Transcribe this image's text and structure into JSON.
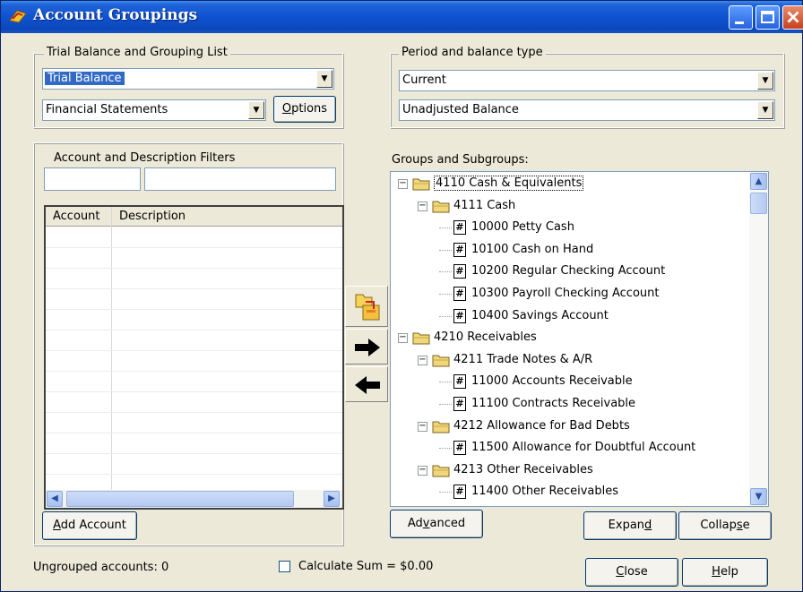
{
  "window": {
    "title": "Account Groupings"
  },
  "trial_balance": {
    "group_label": "Trial Balance and Grouping List",
    "balance_select": "Trial Balance",
    "grouping_select": "Financial Statements",
    "options_button": "Options"
  },
  "period": {
    "group_label": "Period and balance type",
    "period_select": "Current",
    "balance_type_select": "Unadjusted Balance"
  },
  "filters": {
    "group_label": "Account and Description Filters",
    "account_filter": "",
    "description_filter": ""
  },
  "account_list": {
    "columns": [
      "Account",
      "Description"
    ],
    "rows": []
  },
  "tree": {
    "label": "Groups and Subgroups:",
    "nodes": [
      {
        "text": "4110  Cash & Equivalents",
        "level": 0,
        "kind": "folder"
      },
      {
        "text": "4111  Cash",
        "level": 1,
        "kind": "folder"
      },
      {
        "text": "10000  Petty Cash",
        "level": 2,
        "kind": "account"
      },
      {
        "text": "10100  Cash on Hand",
        "level": 2,
        "kind": "account"
      },
      {
        "text": "10200  Regular Checking Account",
        "level": 2,
        "kind": "account"
      },
      {
        "text": "10300  Payroll Checking Account",
        "level": 2,
        "kind": "account"
      },
      {
        "text": "10400  Savings Account",
        "level": 2,
        "kind": "account"
      },
      {
        "text": "4210  Receivables",
        "level": 0,
        "kind": "folder"
      },
      {
        "text": "4211  Trade Notes & A/R",
        "level": 1,
        "kind": "folder"
      },
      {
        "text": "11000  Accounts Receivable",
        "level": 2,
        "kind": "account"
      },
      {
        "text": "11100  Contracts Receivable",
        "level": 2,
        "kind": "account"
      },
      {
        "text": "4212  Allowance for Bad Debts",
        "level": 1,
        "kind": "folder"
      },
      {
        "text": "11500  Allowance for Doubtful Account",
        "level": 2,
        "kind": "account"
      },
      {
        "text": "4213  Other Receivables",
        "level": 1,
        "kind": "folder"
      },
      {
        "text": "11400  Other Receivables",
        "level": 2,
        "kind": "account"
      }
    ]
  },
  "buttons": {
    "add_account": "Add Account",
    "advanced_a": "Ad",
    "advanced_u": "v",
    "advanced_b": "anced",
    "expand_a": "Expan",
    "expand_u": "d",
    "collapse_a": "Collap",
    "collapse_u": "s",
    "collapse_b": "e",
    "close_u": "C",
    "close_b": "lose",
    "help_u": "H",
    "help_b": "elp",
    "options_u": "O",
    "options_b": "ptions",
    "add_a": "",
    "add_u": "A",
    "add_b": "dd Account"
  },
  "footer": {
    "ungrouped": "Ungrouped accounts: 0",
    "calculate_sum": "Calculate Sum = $0.00"
  },
  "icons": {
    "app": "app-icon",
    "group_move": "folder-move-icon",
    "add_right": "arrow-right-icon",
    "remove_left": "arrow-left-icon"
  },
  "colors": {
    "title_bar": "#0F52D0",
    "selection": "#316AC5",
    "dialog_bg": "#ECE9D8"
  }
}
